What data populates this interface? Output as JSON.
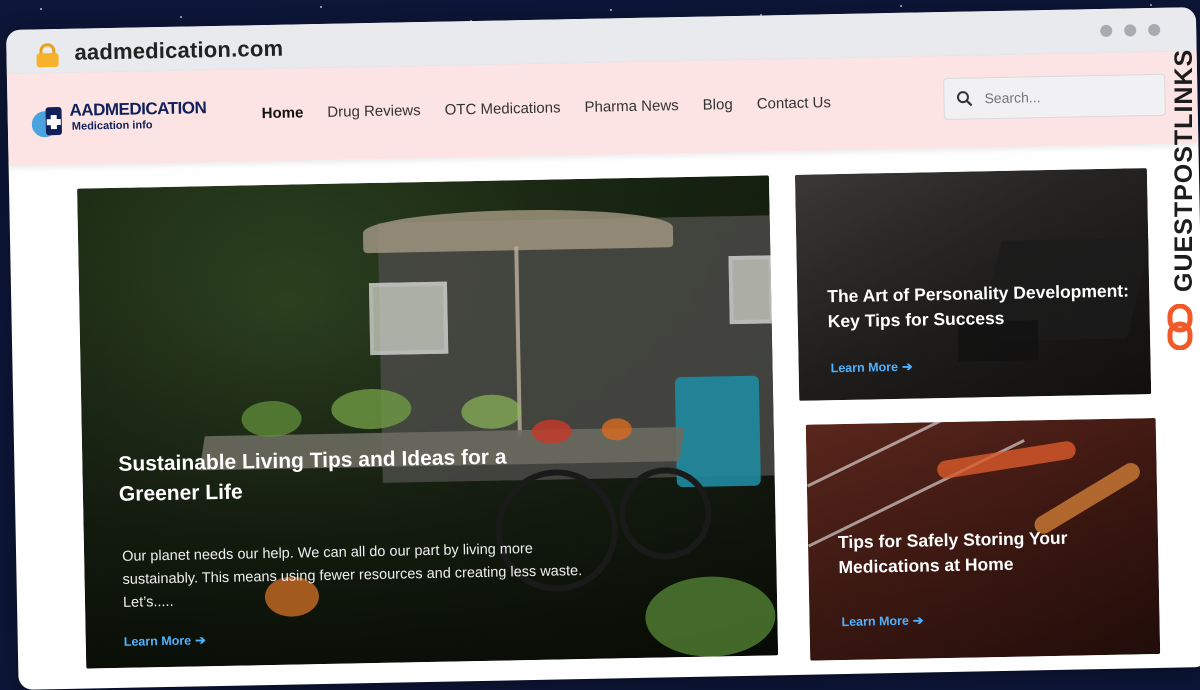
{
  "browser": {
    "url": "aadmedication.com"
  },
  "header": {
    "logo_title": "AADMEDICATION",
    "logo_subtitle": "Medication info",
    "nav": [
      {
        "label": "Home",
        "active": true
      },
      {
        "label": "Drug Reviews"
      },
      {
        "label": "OTC Medications"
      },
      {
        "label": "Pharma News"
      },
      {
        "label": "Blog"
      },
      {
        "label": "Contact Us"
      }
    ],
    "search_placeholder": "Search..."
  },
  "featured": {
    "title": "Sustainable Living Tips and Ideas for a Greener Life",
    "excerpt": "Our planet needs our help. We can all do our part by living more sustainably. This means using fewer resources and creating less waste. Let’s.....",
    "link": "Learn More"
  },
  "side_posts": [
    {
      "title": "The Art of Personality Development: Key Tips for Success",
      "link": "Learn More"
    },
    {
      "title": "Tips for Safely Storing Your Medications at Home",
      "link": "Learn More"
    }
  ],
  "watermark": "GUESTPOSTLINKS",
  "colors": {
    "header_bg": "#fde4e4",
    "link": "#4fb2ff",
    "logo_blue": "#10205a",
    "logo_light_blue": "#4aa3df",
    "watermark_accent": "#f05a28"
  }
}
